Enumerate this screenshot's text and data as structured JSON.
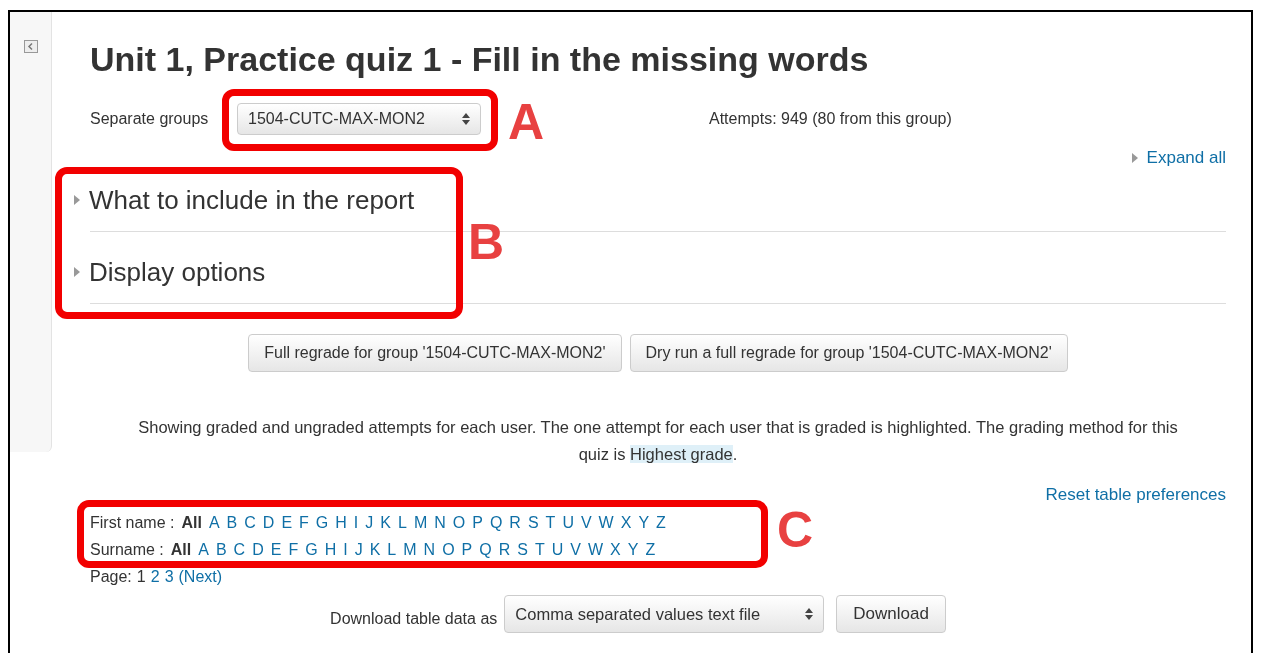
{
  "title": "Unit 1, Practice quiz 1 - Fill in the missing words",
  "group_filter": {
    "label": "Separate groups",
    "value": "1504-CUTC-MAX-MON2"
  },
  "attempts": "Attempts: 949 (80 from this group)",
  "expand_all": "Expand all",
  "sections": [
    {
      "label": "What to include in the report",
      "expanded": false
    },
    {
      "label": "Display options",
      "expanded": false
    }
  ],
  "buttons": [
    "Full regrade for group '1504-CUTC-MAX-MON2'",
    "Dry run a full regrade for group '1504-CUTC-MAX-MON2'"
  ],
  "info": {
    "text_before": "Showing graded and ungraded attempts for each user. The one attempt for each user that is graded is highlighted. The grading method for this quiz is ",
    "highlight": "Highest grade",
    "text_after": "."
  },
  "reset_link": "Reset table preferences",
  "initials_filters": [
    {
      "label": "First name :",
      "options": [
        {
          "text": "All",
          "selected": true
        },
        {
          "text": "A",
          "selected": false
        },
        {
          "text": "B",
          "selected": false
        },
        {
          "text": "C",
          "selected": false
        },
        {
          "text": "D",
          "selected": false
        },
        {
          "text": "E",
          "selected": false
        },
        {
          "text": "F",
          "selected": false
        },
        {
          "text": "G",
          "selected": false
        },
        {
          "text": "H",
          "selected": false
        },
        {
          "text": "I",
          "selected": false
        },
        {
          "text": "J",
          "selected": false
        },
        {
          "text": "K",
          "selected": false
        },
        {
          "text": "L",
          "selected": false
        },
        {
          "text": "M",
          "selected": false
        },
        {
          "text": "N",
          "selected": false
        },
        {
          "text": "O",
          "selected": false
        },
        {
          "text": "P",
          "selected": false
        },
        {
          "text": "Q",
          "selected": false
        },
        {
          "text": "R",
          "selected": false
        },
        {
          "text": "S",
          "selected": false
        },
        {
          "text": "T",
          "selected": false
        },
        {
          "text": "U",
          "selected": false
        },
        {
          "text": "V",
          "selected": false
        },
        {
          "text": "W",
          "selected": false
        },
        {
          "text": "X",
          "selected": false
        },
        {
          "text": "Y",
          "selected": false
        },
        {
          "text": "Z",
          "selected": false
        }
      ]
    },
    {
      "label": "Surname :",
      "options": [
        {
          "text": "All",
          "selected": true
        },
        {
          "text": "A",
          "selected": false
        },
        {
          "text": "B",
          "selected": false
        },
        {
          "text": "C",
          "selected": false
        },
        {
          "text": "D",
          "selected": false
        },
        {
          "text": "E",
          "selected": false
        },
        {
          "text": "F",
          "selected": false
        },
        {
          "text": "G",
          "selected": false
        },
        {
          "text": "H",
          "selected": false
        },
        {
          "text": "I",
          "selected": false
        },
        {
          "text": "J",
          "selected": false
        },
        {
          "text": "K",
          "selected": false
        },
        {
          "text": "L",
          "selected": false
        },
        {
          "text": "M",
          "selected": false
        },
        {
          "text": "N",
          "selected": false
        },
        {
          "text": "O",
          "selected": false
        },
        {
          "text": "P",
          "selected": false
        },
        {
          "text": "Q",
          "selected": false
        },
        {
          "text": "R",
          "selected": false
        },
        {
          "text": "S",
          "selected": false
        },
        {
          "text": "T",
          "selected": false
        },
        {
          "text": "U",
          "selected": false
        },
        {
          "text": "V",
          "selected": false
        },
        {
          "text": "W",
          "selected": false
        },
        {
          "text": "X",
          "selected": false
        },
        {
          "text": "Y",
          "selected": false
        },
        {
          "text": "Z",
          "selected": false
        }
      ]
    }
  ],
  "pagination": {
    "label": "Page:",
    "pages": [
      {
        "text": "1",
        "selected": true
      },
      {
        "text": "2",
        "selected": false
      },
      {
        "text": "3",
        "selected": false
      }
    ],
    "next": "(Next)"
  },
  "download": {
    "label": "Download table data as",
    "format": "Comma separated values text file",
    "button": "Download"
  },
  "annotations": [
    {
      "label": "A"
    },
    {
      "label": "B"
    },
    {
      "label": "C"
    }
  ]
}
